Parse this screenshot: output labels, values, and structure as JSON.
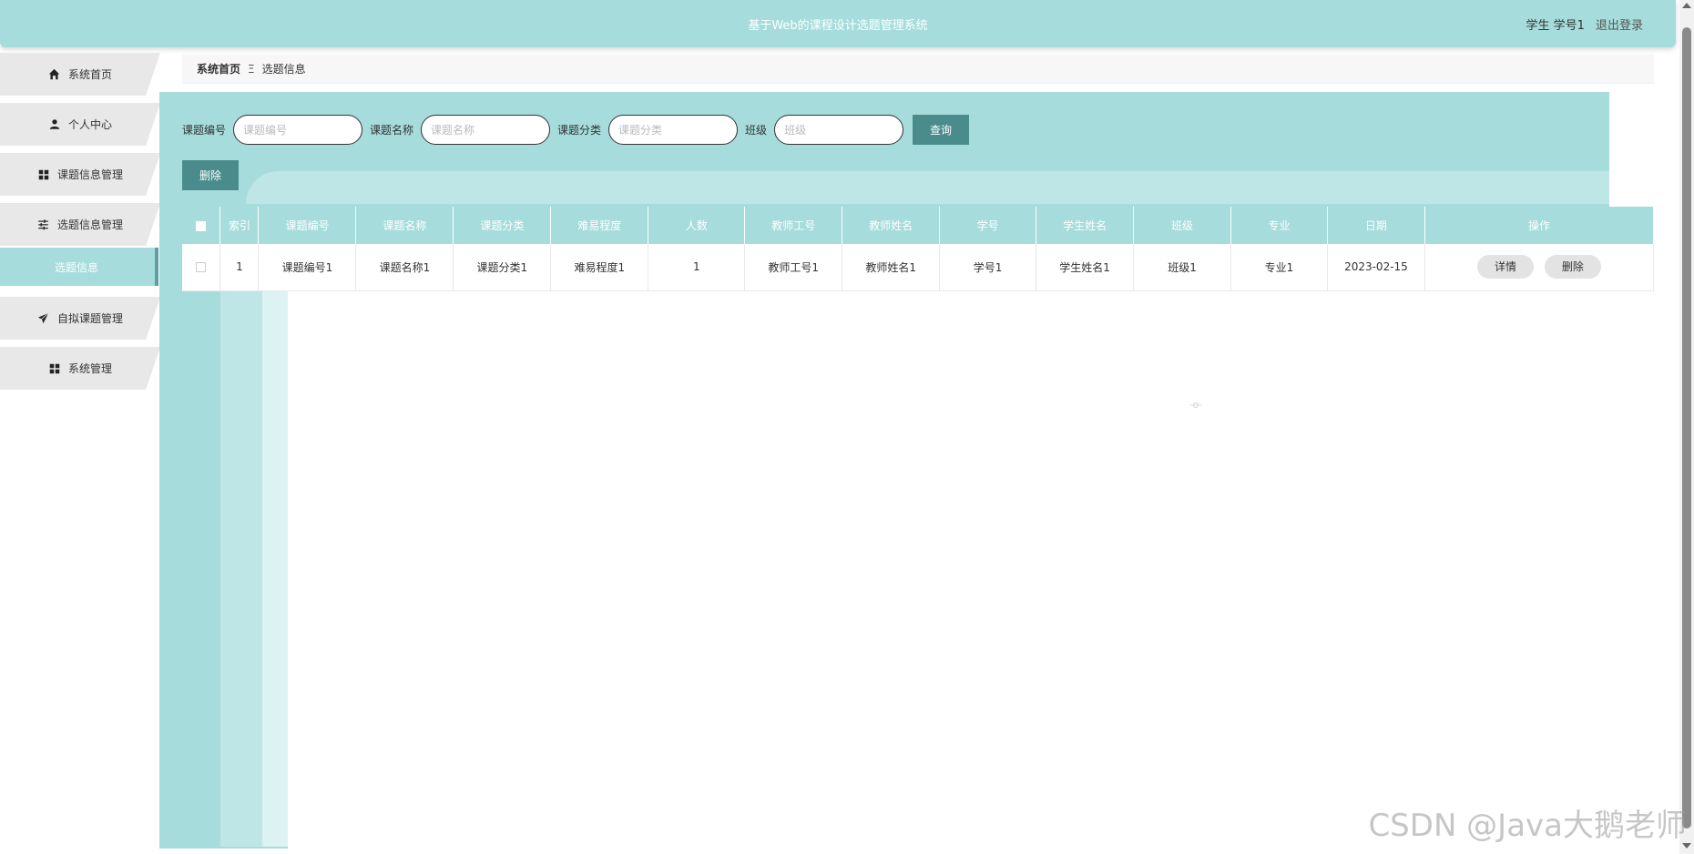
{
  "header": {
    "title": "基于Web的课程设计选题管理系统",
    "user": "学生 学号1",
    "logout": "退出登录"
  },
  "sidebar": {
    "items": [
      {
        "label": "系统首页",
        "icon": "home-icon"
      },
      {
        "label": "个人中心",
        "icon": "user-icon"
      },
      {
        "label": "课题信息管理",
        "icon": "grid-icon"
      },
      {
        "label": "选题信息管理",
        "icon": "sliders-icon"
      },
      {
        "label": "选题信息",
        "icon": ""
      },
      {
        "label": "自拟课题管理",
        "icon": "send-icon"
      },
      {
        "label": "系统管理",
        "icon": "grid-icon"
      }
    ]
  },
  "breadcrumb": {
    "home": "系统首页",
    "separator": "Ξ",
    "current": "选题信息"
  },
  "search": {
    "fields": [
      {
        "label": "课题编号",
        "placeholder": "课题编号"
      },
      {
        "label": "课题名称",
        "placeholder": "课题名称"
      },
      {
        "label": "课题分类",
        "placeholder": "课题分类"
      },
      {
        "label": "班级",
        "placeholder": "班级"
      }
    ],
    "query_label": "查询"
  },
  "toolbar": {
    "delete_label": "删除"
  },
  "table": {
    "headers": [
      "索引",
      "课题编号",
      "课题名称",
      "课题分类",
      "难易程度",
      "人数",
      "教师工号",
      "教师姓名",
      "学号",
      "学生姓名",
      "班级",
      "专业",
      "日期",
      "操作"
    ],
    "rows": [
      {
        "cells": [
          "1",
          "课题编号1",
          "课题名称1",
          "课题分类1",
          "难易程度1",
          "1",
          "教师工号1",
          "教师姓名1",
          "学号1",
          "学生姓名1",
          "班级1",
          "专业1",
          "2023-02-15"
        ],
        "actions": [
          "详情",
          "删除"
        ]
      }
    ]
  },
  "watermark": "CSDN @Java大鹅老师",
  "colors": {
    "accent": "#a6dcdc",
    "button": "#4a8c8c"
  }
}
